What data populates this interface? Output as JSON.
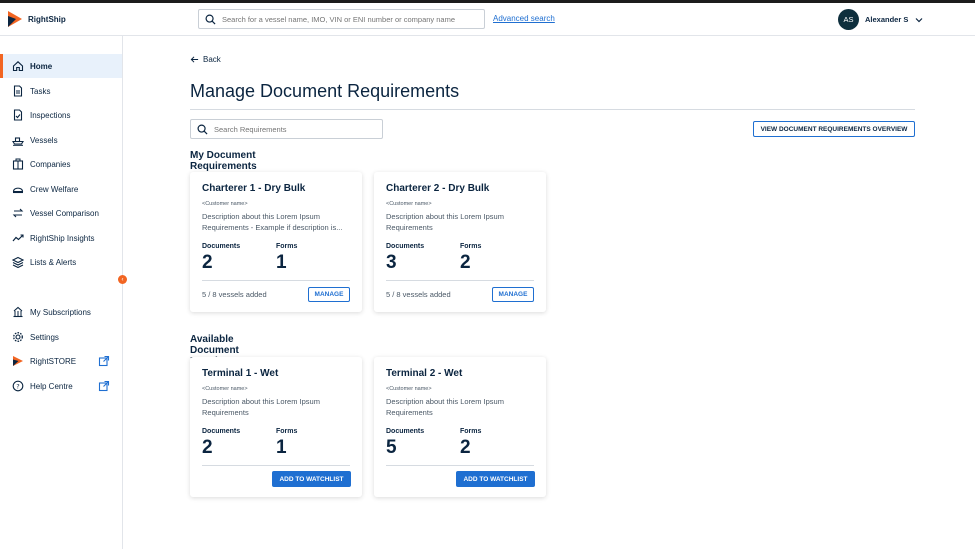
{
  "app": {
    "name": "RightShip"
  },
  "header": {
    "search_placeholder": "Search for a vessel name, IMO, VIN or ENI number or company name",
    "advanced_search": "Advanced search",
    "user_initials": "AS",
    "user_name": "Alexander S"
  },
  "sidebar": {
    "items": [
      {
        "label": "Home",
        "icon": "home-icon"
      },
      {
        "label": "Tasks",
        "icon": "document-icon"
      },
      {
        "label": "Inspections",
        "icon": "inspection-icon"
      },
      {
        "label": "Vessels",
        "icon": "ship-icon"
      },
      {
        "label": "Companies",
        "icon": "building-icon"
      },
      {
        "label": "Crew Welfare",
        "icon": "helmet-icon"
      },
      {
        "label": "Vessel Comparison",
        "icon": "compare-icon"
      },
      {
        "label": "RightShip Insights",
        "icon": "chart-icon"
      },
      {
        "label": "Lists & Alerts",
        "icon": "layers-icon"
      }
    ],
    "bottom_items": [
      {
        "label": "My Subscriptions",
        "icon": "subscription-icon"
      },
      {
        "label": "Settings",
        "icon": "gear-icon"
      },
      {
        "label": "RightSTORE",
        "icon": "store-icon"
      },
      {
        "label": "Help Centre",
        "icon": "help-icon"
      }
    ]
  },
  "page": {
    "back": "Back",
    "title": "Manage Document Requirements",
    "search_placeholder": "Search Requirements",
    "overview_button": "VIEW DOCUMENT REQUIREMENTS OVERVIEW",
    "my_section": "My Document Requirements",
    "available_section": "Available Document Requirements",
    "documents_label": "Documents",
    "forms_label": "Forms",
    "manage_label": "MANAGE",
    "watchlist_label": "ADD TO WATCHLIST"
  },
  "my_cards": [
    {
      "title": "Charterer 1 - Dry Bulk",
      "customer": "<Customer name>",
      "description": "Description about this Lorem Ipsum Requirements - Example if description is...",
      "documents": "2",
      "forms": "1",
      "vessels": "5 / 8 vessels added"
    },
    {
      "title": "Charterer 2 - Dry Bulk",
      "customer": "<Customer name>",
      "description": "Description about this Lorem Ipsum Requirements",
      "documents": "3",
      "forms": "2",
      "vessels": "5 / 8 vessels added"
    }
  ],
  "available_cards": [
    {
      "title": "Terminal 1 - Wet",
      "customer": "<Customer name>",
      "description": "Description about this Lorem Ipsum Requirements",
      "documents": "2",
      "forms": "1"
    },
    {
      "title": "Terminal 2 - Wet",
      "customer": "<Customer name>",
      "description": "Description about this Lorem Ipsum Requirements",
      "documents": "5",
      "forms": "2"
    }
  ],
  "colors": {
    "accent": "#1f6fd1",
    "brand_orange": "#f26522",
    "text": "#0b2540"
  }
}
